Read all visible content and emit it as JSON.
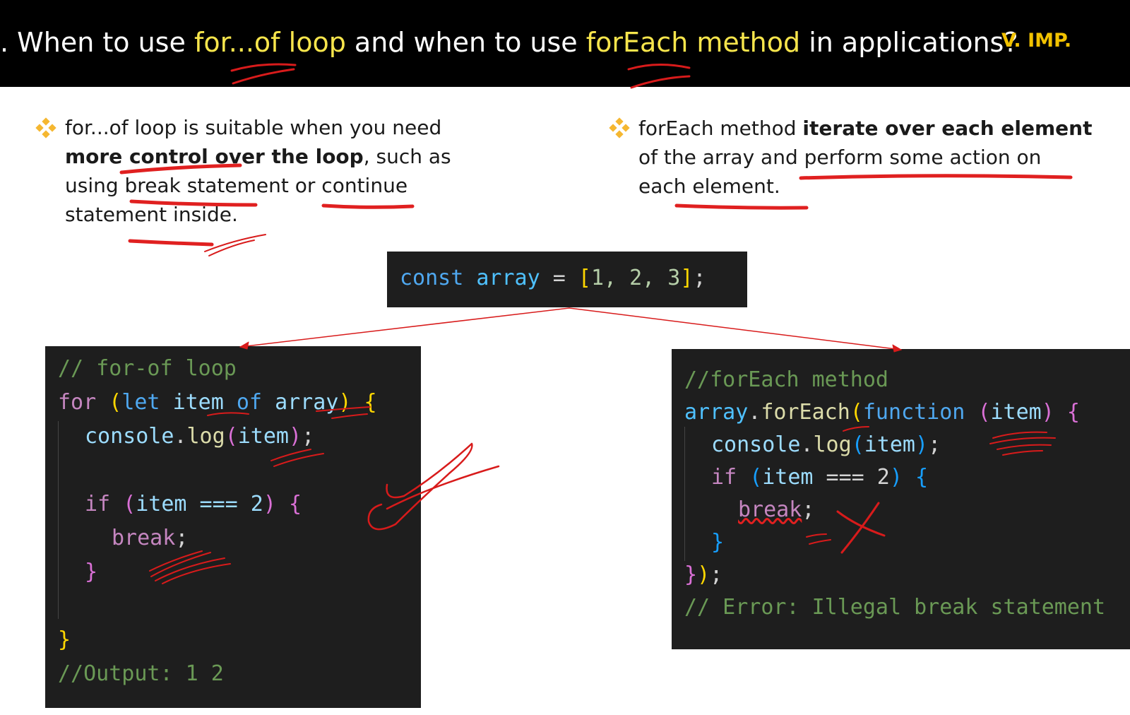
{
  "title": {
    "prefix": ". When to use ",
    "hl1": "for...of loop",
    "mid": " and when to use ",
    "hl2": "forEach method",
    "suffix": " in applications?",
    "importance": "V. IMP."
  },
  "left_bullet": {
    "line1": "for...of loop is suitable when you need",
    "line2_bold": "more control over the loop",
    "line2_rest": ", such as",
    "line3": "using break statement or continue",
    "line4": "statement inside."
  },
  "right_bullet": {
    "line1_plain": "forEach method ",
    "line1_bold": "iterate over each element",
    "line2": "of the array and perform some action on",
    "line3": "each element."
  },
  "top_code": {
    "kw": "const",
    "name": "array",
    "eq": " = ",
    "open": "[",
    "values": "1, 2, 3",
    "close": "]",
    "semi": ";"
  },
  "left_code": {
    "comment": "// for-of loop",
    "for_kw": "for",
    "let_kw": "let",
    "item": "item",
    "of_kw": "of",
    "array": "array",
    "console": "console",
    "log": "log",
    "if_kw": "if",
    "cond": "item === 2",
    "break_kw": "break",
    "output": "//Output: 1 2"
  },
  "right_code": {
    "comment": "//forEach method",
    "array": "array",
    "forEach": "forEach",
    "function_kw": "function",
    "param": "item",
    "console": "console",
    "log": "log",
    "if_kw": "if",
    "cond_item": "item",
    "cond_rest": " === 2",
    "break_kw": "break",
    "error": "// Error: Illegal break statement"
  },
  "colors": {
    "highlight": "#f7e54c",
    "importance": "#f2c200",
    "annotation": "#e02020",
    "code_bg": "#1e1e1e"
  }
}
